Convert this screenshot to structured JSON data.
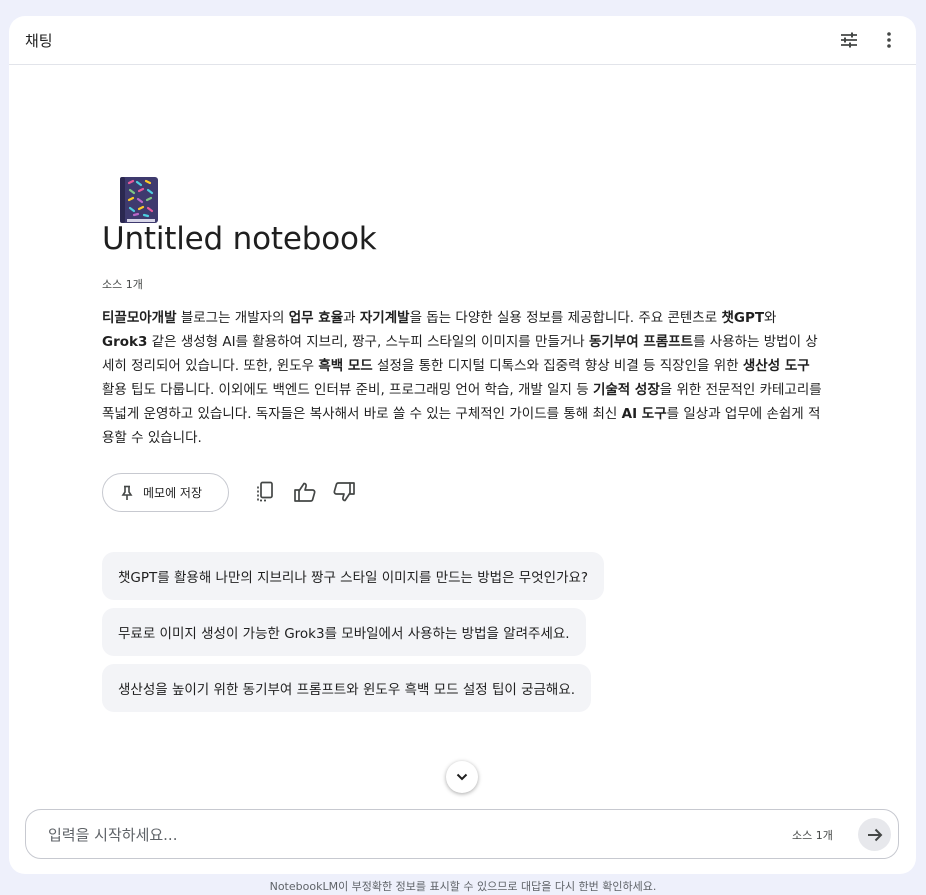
{
  "header": {
    "title": "채팅"
  },
  "notebook": {
    "emoji_icon": "notebook-icon",
    "title": "Untitled notebook",
    "source_count": "소스 1개",
    "summary": [
      {
        "t": "티끌모아개발",
        "b": true
      },
      {
        "t": " 블로그는 개발자의 ",
        "b": false
      },
      {
        "t": "업무 효율",
        "b": true
      },
      {
        "t": "과 ",
        "b": false
      },
      {
        "t": "자기계발",
        "b": true
      },
      {
        "t": "을 돕는 다양한 실용 정보를 제공합니다. 주요 콘텐츠로 ",
        "b": false
      },
      {
        "t": "챗GPT",
        "b": true
      },
      {
        "t": "와 ",
        "b": false
      },
      {
        "t": "Grok3",
        "b": true
      },
      {
        "t": " 같은 생성형 AI를 활용하여 지브리, 짱구, 스누피 스타일의 이미지를 만들거나 ",
        "b": false
      },
      {
        "t": "동기부여 프롬프트",
        "b": true
      },
      {
        "t": "를 사용하는 방법이 상세히 정리되어 있습니다. 또한, 윈도우 ",
        "b": false
      },
      {
        "t": "흑백 모드",
        "b": true
      },
      {
        "t": " 설정을 통한 디지털 디톡스와 집중력 향상 비결 등 직장인을 위한 ",
        "b": false
      },
      {
        "t": "생산성 도구",
        "b": true
      },
      {
        "t": " 활용 팁도 다룹니다. 이외에도 백엔드 인터뷰 준비, 프로그래밍 언어 학습, 개발 일지 등 ",
        "b": false
      },
      {
        "t": "기술적 성장",
        "b": true
      },
      {
        "t": "을 위한 전문적인 카테고리를 폭넓게 운영하고 있습니다. 독자들은 복사해서 바로 쓸 수 있는 구체적인 가이드를 통해 최신 ",
        "b": false
      },
      {
        "t": "AI 도구",
        "b": true
      },
      {
        "t": "를 일상과 업무에 손쉽게 적용할 수 있습니다.",
        "b": false
      }
    ]
  },
  "actions": {
    "save_note_label": "메모에 저장"
  },
  "suggestions": [
    "챗GPT를 활용해 나만의 지브리나 짱구 스타일 이미지를 만드는 방법은 무엇인가요?",
    "무료로 이미지 생성이 가능한 Grok3를 모바일에서 사용하는 방법을 알려주세요.",
    "생산성을 높이기 위한 동기부여 프롬프트와 윈도우 흑백 모드 설정 팁이 궁금해요."
  ],
  "input": {
    "placeholder": "입력을 시작하세요...",
    "value": "",
    "source_count": "소스 1개"
  },
  "footer": {
    "disclaimer": "NotebookLM이 부정확한 정보를 표시할 수 있으므로 대답을 다시 한번 확인하세요."
  },
  "colors": {
    "page_bg": "#eef0fb",
    "panel_bg": "#ffffff",
    "suggestion_bg": "#f3f4f7"
  }
}
